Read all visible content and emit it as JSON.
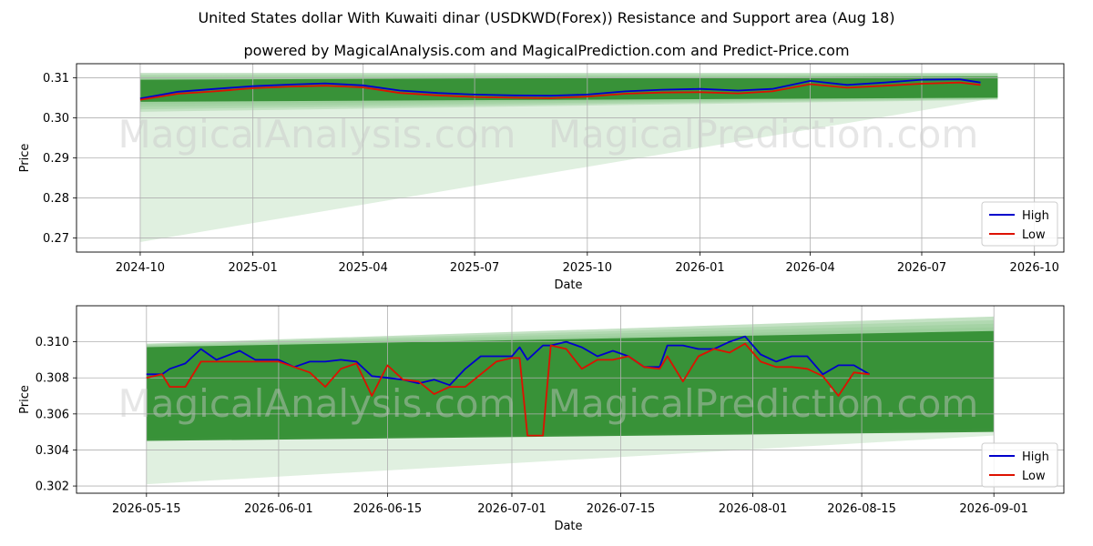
{
  "title": "United States dollar With Kuwaiti dinar (USDKWD(Forex)) Resistance and Support area (Aug 18)",
  "subtitle": "powered by MagicalAnalysis.com and MagicalPrediction.com and Predict-Price.com",
  "watermarks": [
    "MagicalAnalysis.com",
    "MagicalPrediction.com"
  ],
  "colors": {
    "high": "#0000cc",
    "low": "#dd1100",
    "band_dark": "#2e8b2e",
    "band_light": "#8fc98f",
    "band_faint": "#d8ecd8"
  },
  "chart_data": [
    {
      "type": "line",
      "xlabel": "Date",
      "ylabel": "Price",
      "x_ticks": [
        "2024-10",
        "2025-01",
        "2025-04",
        "2025-07",
        "2025-10",
        "2026-01",
        "2026-04",
        "2026-07",
        "2026-10"
      ],
      "y_ticks": [
        "0.27",
        "0.28",
        "0.29",
        "0.30",
        "0.31"
      ],
      "ylim": [
        0.2665,
        0.3135
      ],
      "grid": true,
      "legend": {
        "position": "lower-right",
        "entries": [
          "High",
          "Low"
        ]
      },
      "x_dates": [
        "2024-10-01",
        "2024-11-01",
        "2024-12-01",
        "2025-01-01",
        "2025-02-01",
        "2025-03-01",
        "2025-04-01",
        "2025-05-01",
        "2025-06-01",
        "2025-07-01",
        "2025-08-01",
        "2025-09-01",
        "2025-10-01",
        "2025-11-01",
        "2025-12-01",
        "2026-01-01",
        "2026-02-01",
        "2026-03-01",
        "2026-04-01",
        "2026-05-01",
        "2026-06-01",
        "2026-07-01",
        "2026-08-01",
        "2026-08-18"
      ],
      "series": [
        {
          "name": "High",
          "values": [
            0.3048,
            0.3065,
            0.3072,
            0.3079,
            0.3083,
            0.3086,
            0.3081,
            0.3068,
            0.3062,
            0.3058,
            0.3056,
            0.3055,
            0.3058,
            0.3066,
            0.307,
            0.3072,
            0.3068,
            0.3072,
            0.3092,
            0.3082,
            0.3088,
            0.3095,
            0.3096,
            0.3088
          ]
        },
        {
          "name": "Low",
          "values": [
            0.3045,
            0.306,
            0.3066,
            0.3074,
            0.3078,
            0.308,
            0.3076,
            0.3062,
            0.3056,
            0.3052,
            0.305,
            0.3049,
            0.3053,
            0.306,
            0.3063,
            0.3064,
            0.3061,
            0.3066,
            0.3084,
            0.3075,
            0.308,
            0.3085,
            0.3088,
            0.3082
          ]
        }
      ],
      "bands": {
        "start_date": "2024-10-01",
        "end_date": "2026-09-01",
        "resistance_start": [
          0.3095,
          0.3112
        ],
        "resistance_end": [
          0.3103,
          0.3112
        ],
        "support_start": [
          0.3015,
          0.304
        ],
        "support_end": [
          0.3045,
          0.305
        ],
        "faint_low_start": 0.269,
        "faint_low_end": 0.305
      }
    },
    {
      "type": "line",
      "xlabel": "Date",
      "ylabel": "Price",
      "x_ticks": [
        "2026-05-15",
        "2026-06-01",
        "2026-06-15",
        "2026-07-01",
        "2026-07-15",
        "2026-08-01",
        "2026-08-15",
        "2026-09-01"
      ],
      "y_ticks": [
        "0.302",
        "0.304",
        "0.306",
        "0.308",
        "0.310"
      ],
      "ylim": [
        0.3016,
        0.312
      ],
      "grid": true,
      "legend": {
        "position": "lower-right",
        "entries": [
          "High",
          "Low"
        ]
      },
      "x_dates": [
        "2026-05-15",
        "2026-05-17",
        "2026-05-18",
        "2026-05-20",
        "2026-05-22",
        "2026-05-24",
        "2026-05-27",
        "2026-05-29",
        "2026-06-01",
        "2026-06-03",
        "2026-06-05",
        "2026-06-07",
        "2026-06-09",
        "2026-06-11",
        "2026-06-13",
        "2026-06-15",
        "2026-06-17",
        "2026-06-19",
        "2026-06-21",
        "2026-06-23",
        "2026-06-25",
        "2026-06-27",
        "2026-06-29",
        "2026-07-01",
        "2026-07-02",
        "2026-07-03",
        "2026-07-05",
        "2026-07-06",
        "2026-07-08",
        "2026-07-10",
        "2026-07-12",
        "2026-07-14",
        "2026-07-16",
        "2026-07-18",
        "2026-07-20",
        "2026-07-21",
        "2026-07-23",
        "2026-07-25",
        "2026-07-27",
        "2026-07-29",
        "2026-07-31",
        "2026-08-02",
        "2026-08-04",
        "2026-08-06",
        "2026-08-08",
        "2026-08-10",
        "2026-08-12",
        "2026-08-14",
        "2026-08-16"
      ],
      "series": [
        {
          "name": "High",
          "values": [
            0.3082,
            0.3082,
            0.3085,
            0.3088,
            0.3096,
            0.309,
            0.3095,
            0.309,
            0.309,
            0.3086,
            0.3089,
            0.3089,
            0.309,
            0.3089,
            0.3081,
            0.308,
            0.3079,
            0.3077,
            0.3079,
            0.3076,
            0.3085,
            0.3092,
            0.3092,
            0.3092,
            0.3097,
            0.309,
            0.3098,
            0.3098,
            0.31,
            0.3097,
            0.3092,
            0.3095,
            0.3092,
            0.3086,
            0.3086,
            0.3098,
            0.3098,
            0.3096,
            0.3096,
            0.31,
            0.3103,
            0.3093,
            0.3089,
            0.3092,
            0.3092,
            0.3082,
            0.3087,
            0.3087,
            0.3082
          ]
        },
        {
          "name": "Low",
          "values": [
            0.308,
            0.3082,
            0.3075,
            0.3075,
            0.3089,
            0.3089,
            0.3089,
            0.3089,
            0.3089,
            0.3086,
            0.3083,
            0.3075,
            0.3085,
            0.3088,
            0.307,
            0.3087,
            0.3079,
            0.3078,
            0.3071,
            0.3075,
            0.3075,
            0.3082,
            0.3089,
            0.3091,
            0.3091,
            0.3048,
            0.3048,
            0.3098,
            0.3096,
            0.3085,
            0.309,
            0.309,
            0.3092,
            0.3086,
            0.3085,
            0.3092,
            0.3078,
            0.3092,
            0.3096,
            0.3094,
            0.3099,
            0.3089,
            0.3086,
            0.3086,
            0.3085,
            0.3081,
            0.307,
            0.3083,
            0.3082
          ]
        }
      ],
      "bands": {
        "start_date": "2026-05-15",
        "end_date": "2026-09-01",
        "resistance_start": [
          0.3097,
          0.3099
        ],
        "resistance_end": [
          0.3106,
          0.3114
        ],
        "support_start": [
          0.3047,
          0.3045
        ],
        "support_end": [
          0.3052,
          0.305
        ],
        "faint_low_start": 0.3021,
        "faint_low_end": 0.3048
      }
    }
  ]
}
